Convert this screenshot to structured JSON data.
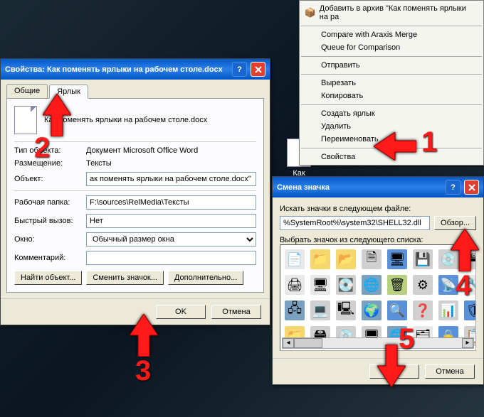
{
  "properties_window": {
    "title": "Свойства: Как поменять ярлыки на рабочем столе.docx",
    "tabs": {
      "general": "Общие",
      "shortcut": "Ярлык"
    },
    "filename": "Как поменять ярлыки на рабочем столе.docx",
    "labels": {
      "type": "Тип объекта:",
      "type_val": "Документ Microsoft Office Word",
      "location": "Размещение:",
      "location_val": "Тексты",
      "target": "Объект:",
      "target_val": "ак поменять ярлыки на рабочем столе.docx\"",
      "workdir": "Рабочая папка:",
      "workdir_val": "F:\\sources\\RelMedia\\Тексты",
      "hotkey": "Быстрый вызов:",
      "hotkey_val": "Нет",
      "run": "Окно:",
      "run_val": "Обычный размер окна",
      "comment": "Комментарий:",
      "comment_val": ""
    },
    "buttons": {
      "find": "Найти объект...",
      "change_icon": "Сменить значок...",
      "advanced": "Дополнительно...",
      "ok": "OK",
      "cancel": "Отмена"
    }
  },
  "context_menu": {
    "add_archive": "Добавить в архив \"Как поменять ярлыки на ра",
    "araxis_compare": "Compare with Araxis Merge",
    "araxis_queue": "Queue for Comparison",
    "send": "Отправить",
    "cut": "Вырезать",
    "copy": "Копировать",
    "create_shortcut": "Создать ярлык",
    "delete": "Удалить",
    "rename": "Переименовать",
    "properties": "Свойства"
  },
  "desktop_icon_label": "Как поменять",
  "change_icon_dialog": {
    "title": "Смена значка",
    "label_find": "Искать значки в следующем файле:",
    "path": "%SystemRoot%\\system32\\SHELL32.dll",
    "browse": "Обзор...",
    "label_list": "Выбрать значок из следующего списка:",
    "ok": "OK",
    "cancel": "Отмена"
  },
  "annotations": {
    "n1": "1",
    "n2": "2",
    "n3": "3",
    "n4": "4",
    "n5": "5"
  }
}
